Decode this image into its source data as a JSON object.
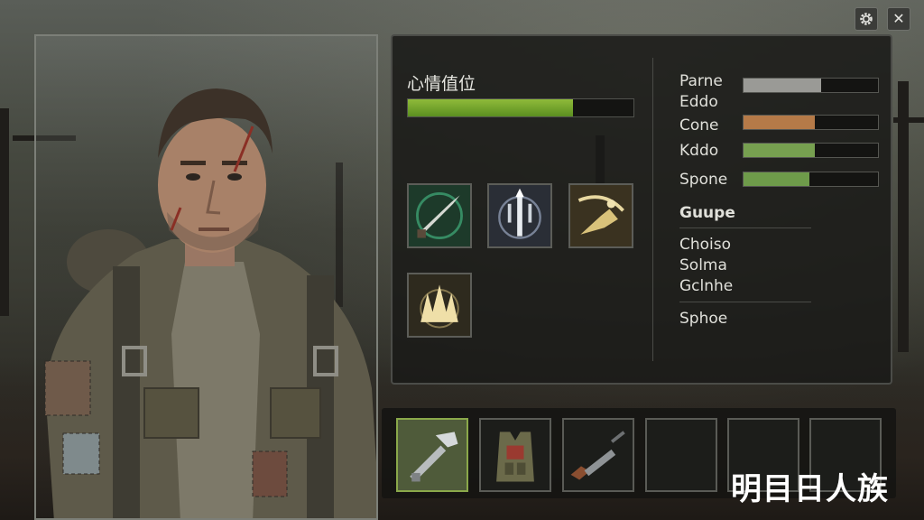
{
  "mood": {
    "label": "心情值位",
    "value": 0.73,
    "color": "#7aab2e"
  },
  "stats": [
    {
      "label": "Parne"
    },
    {
      "label": "Eddo",
      "value": 0.58,
      "color": "#9a9a96"
    },
    {
      "label": "Cone",
      "value": 0.53,
      "color": "#b57a48"
    },
    {
      "label": "Kddo",
      "value": 0.53,
      "color": "#77a050"
    },
    {
      "label": "Spone",
      "value": 0.49,
      "color": "#6e9b4a"
    }
  ],
  "section_heading": "Guupe",
  "list_items": [
    "Choiso",
    "Solma",
    "Gclnhe"
  ],
  "footer_item": "Sphoe",
  "skills": [
    {
      "icon": "spear-icon"
    },
    {
      "icon": "trident-icon"
    },
    {
      "icon": "slash-icon"
    },
    {
      "icon": "spikes-icon"
    }
  ],
  "inventory": [
    {
      "icon": "hammer-icon",
      "selected": true
    },
    {
      "icon": "vest-icon"
    },
    {
      "icon": "rifle-icon"
    },
    {
      "icon": ""
    },
    {
      "icon": ""
    },
    {
      "icon": ""
    }
  ],
  "watermark": "明目日人族"
}
